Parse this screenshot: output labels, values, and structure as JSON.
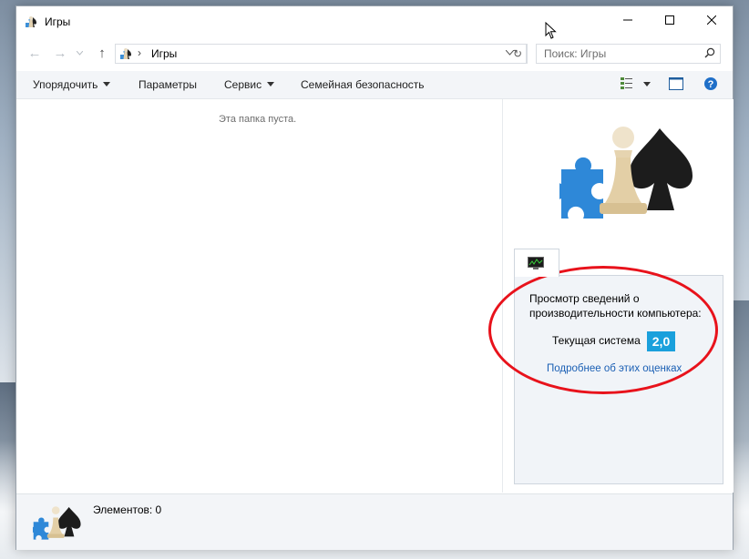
{
  "window": {
    "title": "Игры"
  },
  "address": {
    "path": "Игры",
    "search_placeholder": "Поиск: Игры"
  },
  "toolbar": {
    "organize": "Упорядочить",
    "options": "Параметры",
    "tools": "Сервис",
    "parental": "Семейная безопасность"
  },
  "content": {
    "empty_message": "Эта папка пуста."
  },
  "performance": {
    "title": "Просмотр сведений о производительности компьютера:",
    "current_label": "Текущая система",
    "score": "2,0",
    "link": "Подробнее об этих оценках"
  },
  "status": {
    "items": "Элементов: 0"
  },
  "colors": {
    "accent": "#1aa0dc",
    "link": "#1a5fb4",
    "highlight": "#e8121b"
  }
}
